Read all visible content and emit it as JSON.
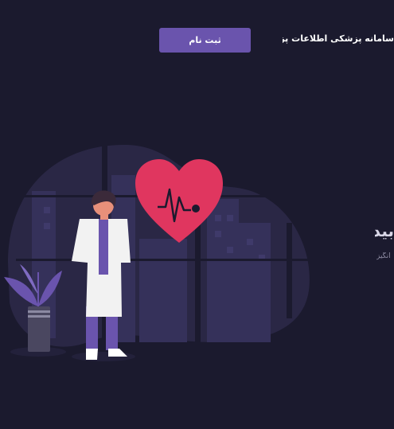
{
  "header": {
    "brand_title": "سامانه پزشکی اطلاعات پزشکی کرونا ویروس",
    "signup_label": "ثبت نام"
  },
  "hero": {
    "title": "بید",
    "subtitle": "انگیز"
  },
  "colors": {
    "background": "#1b1a2e",
    "accent": "#6a54ad",
    "heart": "#e0365f"
  },
  "icons": {
    "heart": "heart-pulse-icon",
    "plant": "potted-plant-icon"
  }
}
